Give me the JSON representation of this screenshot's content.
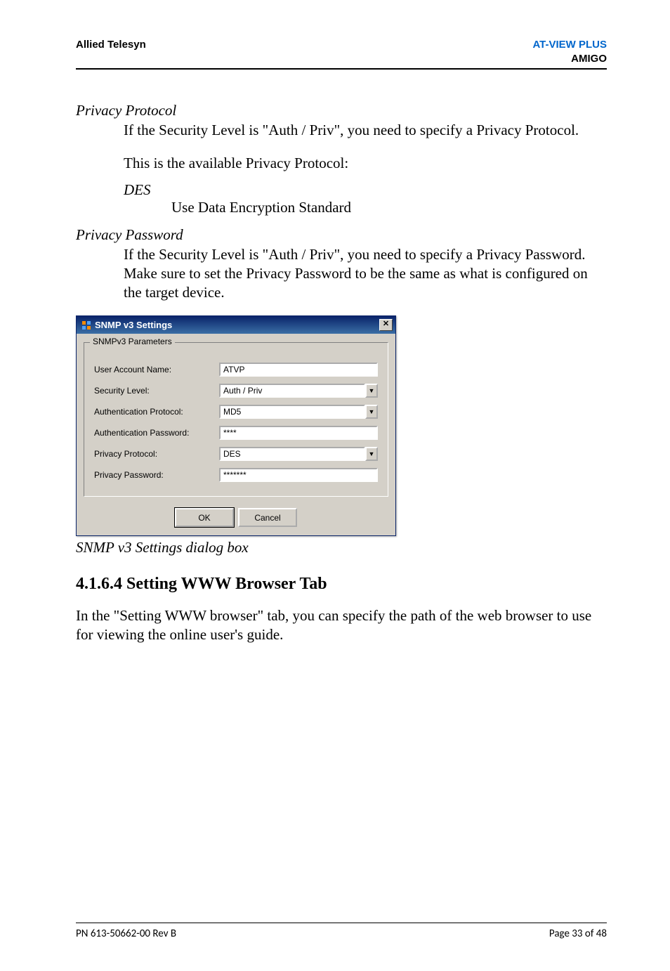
{
  "header": {
    "left": "Allied Telesyn",
    "right_top": "AT-VIEW PLUS",
    "right_bottom": "AMIGO"
  },
  "sections": {
    "priv_proto": {
      "title": "Privacy Protocol",
      "p1": "If the Security Level is \"Auth / Priv\", you need to specify a Privacy Protocol.",
      "p2": "This is the available Privacy Protocol:",
      "term": "DES",
      "def": "Use Data Encryption Standard"
    },
    "priv_pwd": {
      "title": "Privacy Password",
      "p1": "If the Security Level is \"Auth / Priv\", you need to specify a Privacy Password. Make sure to set the Privacy Password to be the same as what is configured on the target device."
    }
  },
  "dialog": {
    "title": "SNMP v3 Settings",
    "close_glyph": "✕",
    "group_label": "SNMPv3 Parameters",
    "rows": {
      "user": {
        "label": "User Account Name:",
        "value": "ATVP"
      },
      "sec": {
        "label": "Security Level:",
        "value": "Auth / Priv"
      },
      "auth_proto": {
        "label": "Authentication Protocol:",
        "value": "MD5"
      },
      "auth_pwd": {
        "label": "Authentication Password:",
        "value": "****"
      },
      "priv_proto": {
        "label": "Privacy Protocol:",
        "value": "DES"
      },
      "priv_pwd": {
        "label": "Privacy Password:",
        "value": "*******"
      }
    },
    "ok": "OK",
    "cancel": "Cancel",
    "dropdown_glyph": "▼"
  },
  "caption": "SNMP v3 Settings dialog box",
  "h3": "4.1.6.4 Setting WWW Browser Tab",
  "after_h3": "In the \"Setting WWW browser\" tab, you can specify the path of the web browser to use for viewing the online user's guide.",
  "footer": {
    "left": "PN 613-50662-00 Rev B",
    "right": "Page 33 of 48"
  }
}
